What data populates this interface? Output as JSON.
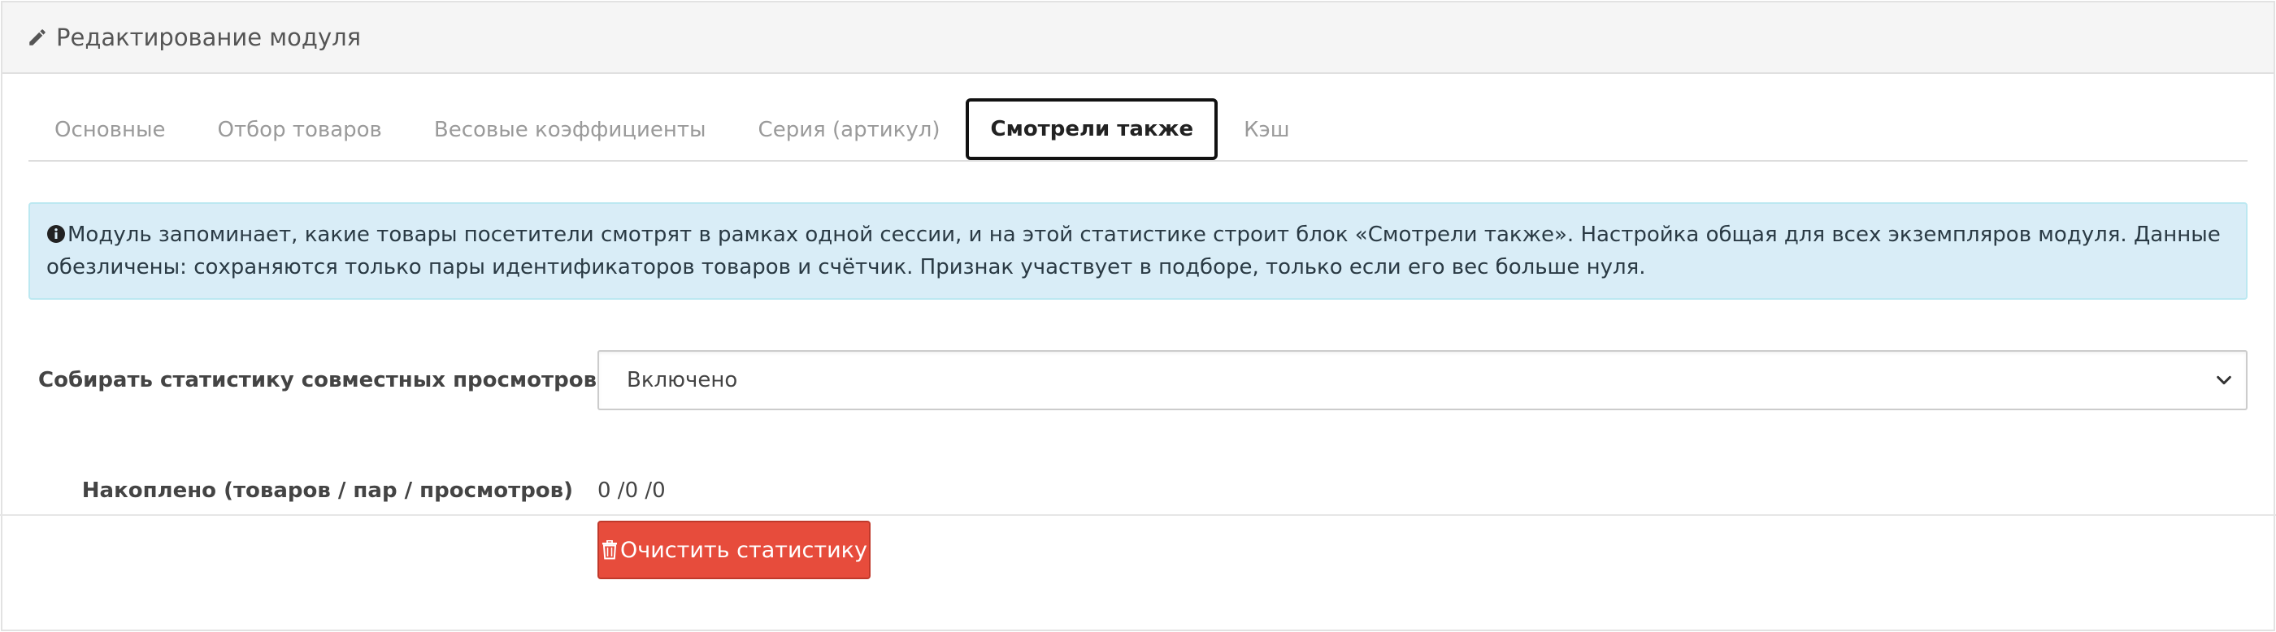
{
  "header": {
    "title": "Редактирование модуля",
    "icon": "pencil-icon"
  },
  "tabs": [
    {
      "label": "Основные",
      "active": false
    },
    {
      "label": "Отбор товаров",
      "active": false
    },
    {
      "label": "Весовые коэффициенты",
      "active": false
    },
    {
      "label": "Серия (артикул)",
      "active": false
    },
    {
      "label": "Смотрели также",
      "active": true
    },
    {
      "label": "Кэш",
      "active": false
    }
  ],
  "alert": {
    "icon": "info-circle-icon",
    "text": "Модуль запоминает, какие товары посетители смотрят в рамках одной сессии, и на этой статистике строит блок «Смотрели также». Настройка общая для всех экземпляров модуля. Данные обезличены: сохраняются только пары идентификаторов товаров и счётчик. Признак участвует в подборе, только если его вес больше нуля."
  },
  "collect_stats": {
    "label": "Собирать статистику совместных просмотров",
    "selected": "Включено"
  },
  "accumulated": {
    "label": "Накоплено (товаров / пар / просмотров)",
    "value": "0 /0 /0"
  },
  "clear_button": {
    "label": "Очистить статистику",
    "icon": "trash-icon"
  },
  "colors": {
    "danger": "#e74c3c",
    "info_bg": "#d9edf7",
    "heading_bg": "#f5f5f5"
  }
}
